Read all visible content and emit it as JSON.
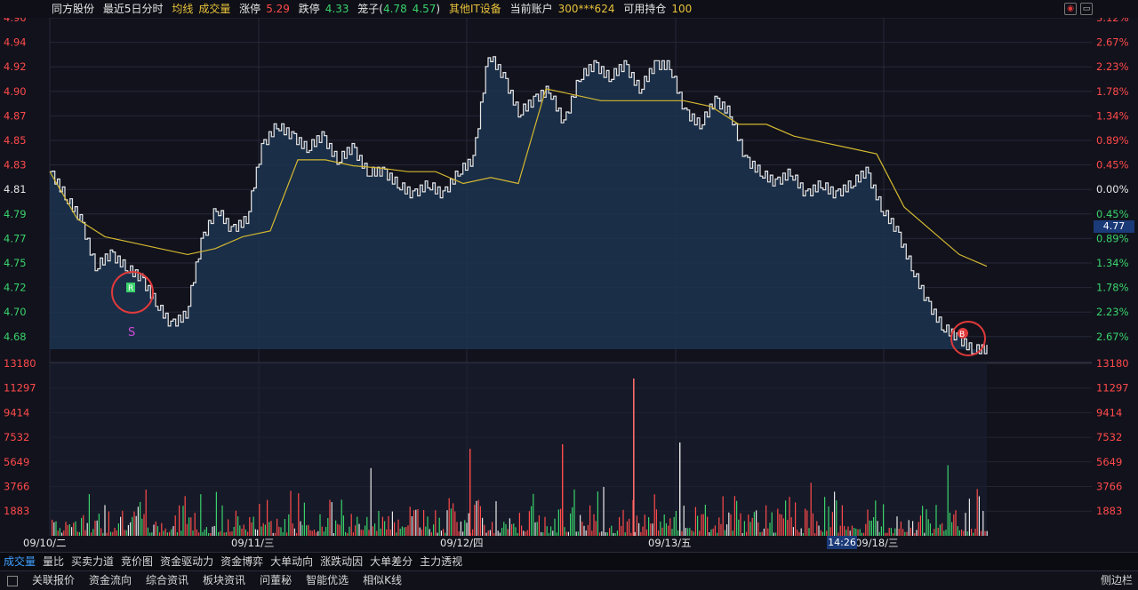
{
  "header": {
    "stock_name": "同方股份",
    "period": "最近5日分时",
    "avg_line": "均线",
    "volume": "成交量",
    "limit_up_label": "涨停",
    "limit_up_value": "5.29",
    "limit_down_label": "跌停",
    "limit_down_value": "4.33",
    "cage_label": "笼子(",
    "cage_high": "4.78",
    "cage_low": "4.57",
    "cage_close": ")",
    "sector": "其他IT设备",
    "account_label": "当前账户",
    "account_value": "300***624",
    "holding_label": "可用持仓",
    "holding_value": "100"
  },
  "price_axis": [
    "4.96",
    "4.94",
    "4.92",
    "4.90",
    "4.87",
    "4.85",
    "4.83",
    "4.81",
    "4.79",
    "4.77",
    "4.75",
    "4.72",
    "4.70",
    "4.68"
  ],
  "pct_axis": [
    "3.12%",
    "2.67%",
    "2.23%",
    "1.78%",
    "1.34%",
    "0.89%",
    "0.45%",
    "0.00%",
    "0.45%",
    "0.89%",
    "1.34%",
    "1.78%",
    "2.23%",
    "2.67%"
  ],
  "volume_axis": [
    "13180",
    "11297",
    "9414",
    "7532",
    "5649",
    "3766",
    "1883"
  ],
  "dates": [
    "09/10/二",
    "09/11/三",
    "09/12/四",
    "09/13/五",
    "09/18/三"
  ],
  "current_price_tag": "4.77",
  "crosshair_time": "14:26",
  "markers": {
    "sell_label": "S",
    "trade_b": "B",
    "trade_r": "R"
  },
  "colors": {
    "up": "#ff4a4a",
    "down": "#3ad36b",
    "avg": "#d4b830",
    "price": "#e8e8e8",
    "fill": "#1c3450"
  },
  "chart_data": {
    "type": "line",
    "title": "同方股份 最近5日分时",
    "ylim": [
      4.68,
      4.96
    ],
    "prev_close": 4.81,
    "days": [
      "09/10",
      "09/11",
      "09/12",
      "09/13",
      "09/18"
    ],
    "series": [
      {
        "name": "price",
        "values": [
          4.83,
          4.81,
          4.79,
          4.75,
          4.76,
          4.75,
          4.74,
          4.72,
          4.7,
          4.71,
          4.77,
          4.8,
          4.78,
          4.79,
          4.85,
          4.87,
          4.86,
          4.85,
          4.86,
          4.84,
          4.85,
          4.83,
          4.83,
          4.82,
          4.81,
          4.82,
          4.81,
          4.83,
          4.84,
          4.93,
          4.91,
          4.88,
          4.89,
          4.9,
          4.87,
          4.91,
          4.92,
          4.91,
          4.92,
          4.9,
          4.92,
          4.92,
          4.88,
          4.87,
          4.89,
          4.88,
          4.84,
          4.83,
          4.82,
          4.83,
          4.81,
          4.82,
          4.81,
          4.82,
          4.83,
          4.8,
          4.78,
          4.75,
          4.72,
          4.7,
          4.69,
          4.68,
          4.68
        ]
      },
      {
        "name": "avg",
        "values": [
          4.83,
          4.79,
          4.775,
          4.77,
          4.765,
          4.76,
          4.765,
          4.775,
          4.78,
          4.84,
          4.84,
          4.835,
          4.833,
          4.83,
          4.83,
          4.82,
          4.825,
          4.82,
          4.9,
          4.895,
          4.89,
          4.89,
          4.89,
          4.89,
          4.885,
          4.87,
          4.87,
          4.86,
          4.855,
          4.85,
          4.845,
          4.8,
          4.78,
          4.76,
          4.75
        ]
      }
    ],
    "volume_max": 13180
  }
}
